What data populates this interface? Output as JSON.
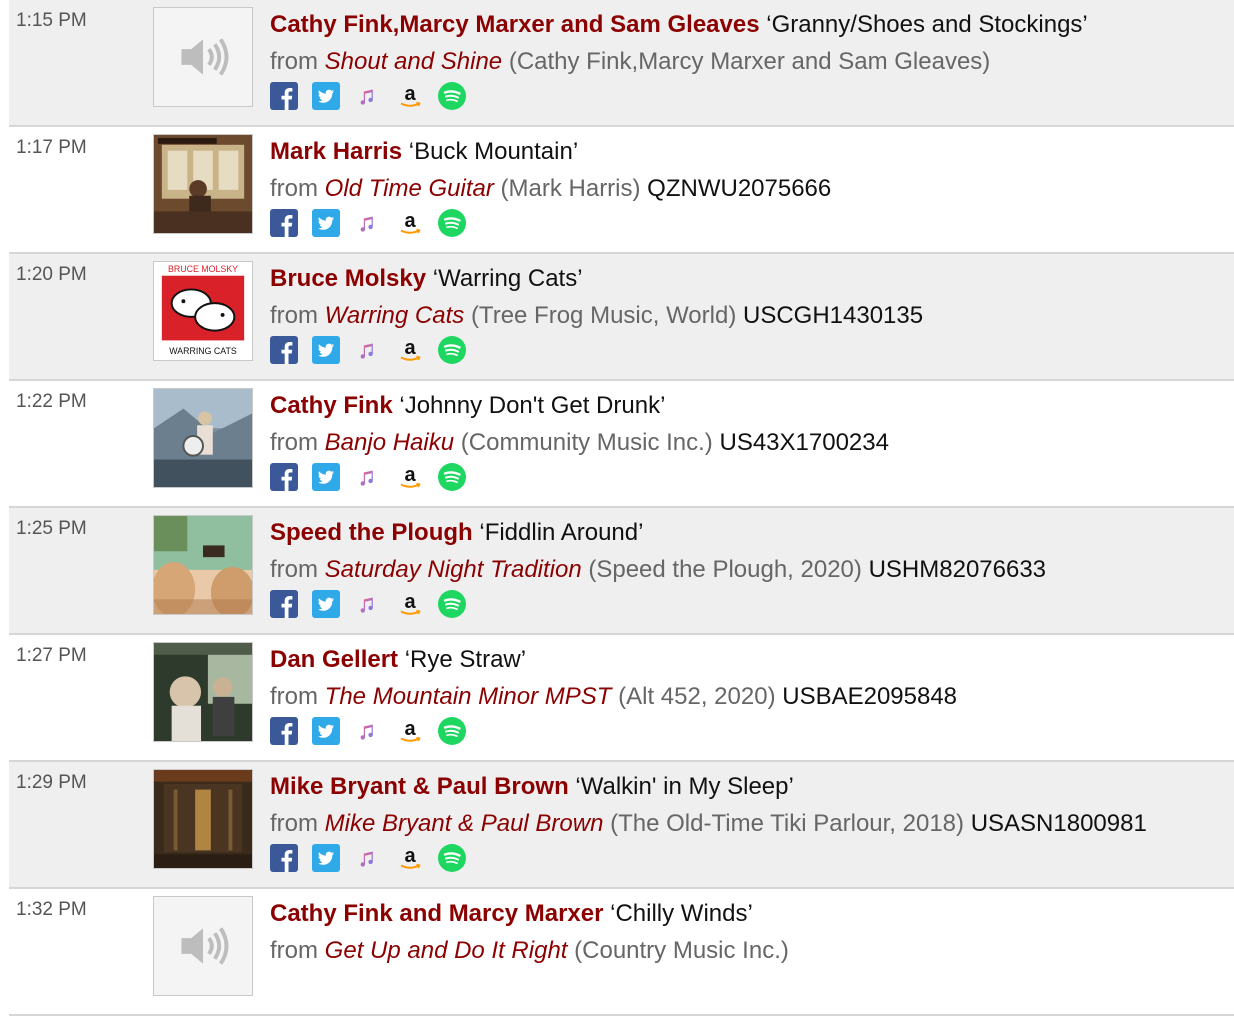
{
  "playlist": [
    {
      "time": "1:15 PM",
      "artist": "Cathy Fink,Marcy Marxer and Sam Gleaves",
      "title": "‘Granny/Shoes and Stockings’",
      "from": "from",
      "album": "Shout and Shine",
      "label": "(Cathy Fink,Marcy Marxer and Sam Gleaves)",
      "isrc": "",
      "art": "speaker-placeholder"
    },
    {
      "time": "1:17 PM",
      "artist": "Mark Harris",
      "title": "‘Buck Mountain’",
      "from": "from",
      "album": "Old Time Guitar",
      "label": "(Mark Harris)",
      "isrc": "QZNWU2075666",
      "art": "album-cover"
    },
    {
      "time": "1:20 PM",
      "artist": "Bruce Molsky",
      "title": "‘Warring Cats’",
      "from": "from",
      "album": "Warring Cats",
      "label": "(Tree Frog Music, World)",
      "isrc": "USCGH1430135",
      "art": "album-cover",
      "art_text": [
        "BRUCE MOLSKY",
        "WARRING CATS"
      ]
    },
    {
      "time": "1:22 PM",
      "artist": "Cathy Fink",
      "title": "‘Johnny Don't Get Drunk’",
      "from": "from",
      "album": "Banjo Haiku",
      "label": "(Community Music Inc.)",
      "isrc": "US43X1700234",
      "art": "album-cover"
    },
    {
      "time": "1:25 PM",
      "artist": "Speed the Plough",
      "title": "‘Fiddlin Around’",
      "from": "from",
      "album": "Saturday Night Tradition",
      "label": "(Speed the Plough, 2020)",
      "isrc": "USHM82076633",
      "art": "album-cover"
    },
    {
      "time": "1:27 PM",
      "artist": "Dan Gellert",
      "title": "‘Rye Straw’",
      "from": "from",
      "album": "The Mountain Minor MPST",
      "label": "(Alt 452, 2020)",
      "isrc": "USBAE2095848",
      "art": "album-cover"
    },
    {
      "time": "1:29 PM",
      "artist": "Mike Bryant & Paul Brown",
      "title": "‘Walkin' in My Sleep’",
      "from": "from",
      "album": "Mike Bryant & Paul Brown",
      "label": "(The Old-Time Tiki Parlour, 2018)",
      "isrc": "USASN1800981",
      "art": "album-cover"
    },
    {
      "time": "1:32 PM",
      "artist": "Cathy Fink and Marcy Marxer",
      "title": "‘Chilly Winds’",
      "from": "from",
      "album": "Get Up and Do It Right",
      "label": "(Country Music Inc.)",
      "isrc": "",
      "art": "speaker-placeholder"
    }
  ],
  "share_icons": [
    "facebook-icon",
    "twitter-icon",
    "apple-music-icon",
    "amazon-icon",
    "spotify-icon"
  ],
  "colors": {
    "artist": "#8b0000",
    "row_shaded": "#efefef",
    "facebook": "#3b5998",
    "twitter": "#2fa9e8",
    "spotify": "#1ed760"
  }
}
